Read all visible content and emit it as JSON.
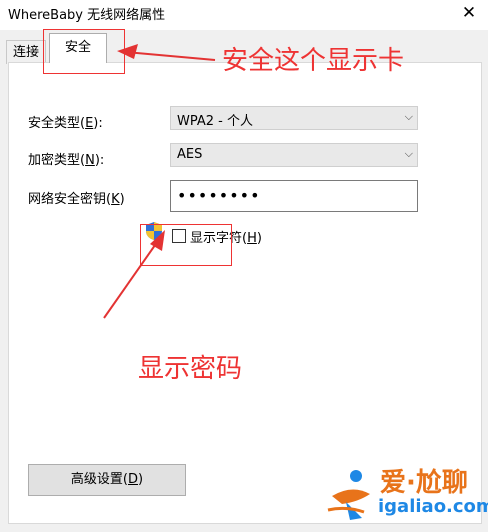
{
  "window": {
    "title": "WhereBaby 无线网络属性",
    "close_glyph": "✕"
  },
  "tabs": [
    {
      "label": "连接"
    },
    {
      "label": "安全"
    }
  ],
  "fields": {
    "security_type": {
      "label_pre": "安全类型(",
      "label_key": "E",
      "label_post": "):",
      "value": "WPA2 - 个人"
    },
    "encryption_type": {
      "label_pre": "加密类型(",
      "label_key": "N",
      "label_post": "):",
      "value": "AES"
    },
    "network_key": {
      "label_pre": "网络安全密钥(",
      "label_key": "K",
      "label_post": ")",
      "value": "••••••••"
    }
  },
  "show_chars": {
    "label_pre": "显示字符(",
    "label_key": "H",
    "label_post": ")",
    "checked": false
  },
  "advanced_button": {
    "label_pre": "高级设置(",
    "label_key": "D",
    "label_post": ")"
  },
  "annotations": {
    "tab_note": "安全这个显示卡",
    "password_note": "显示密码",
    "color": "#e33333"
  },
  "watermark": {
    "line1": "爱·尬聊",
    "line2": "igaliao.com"
  }
}
